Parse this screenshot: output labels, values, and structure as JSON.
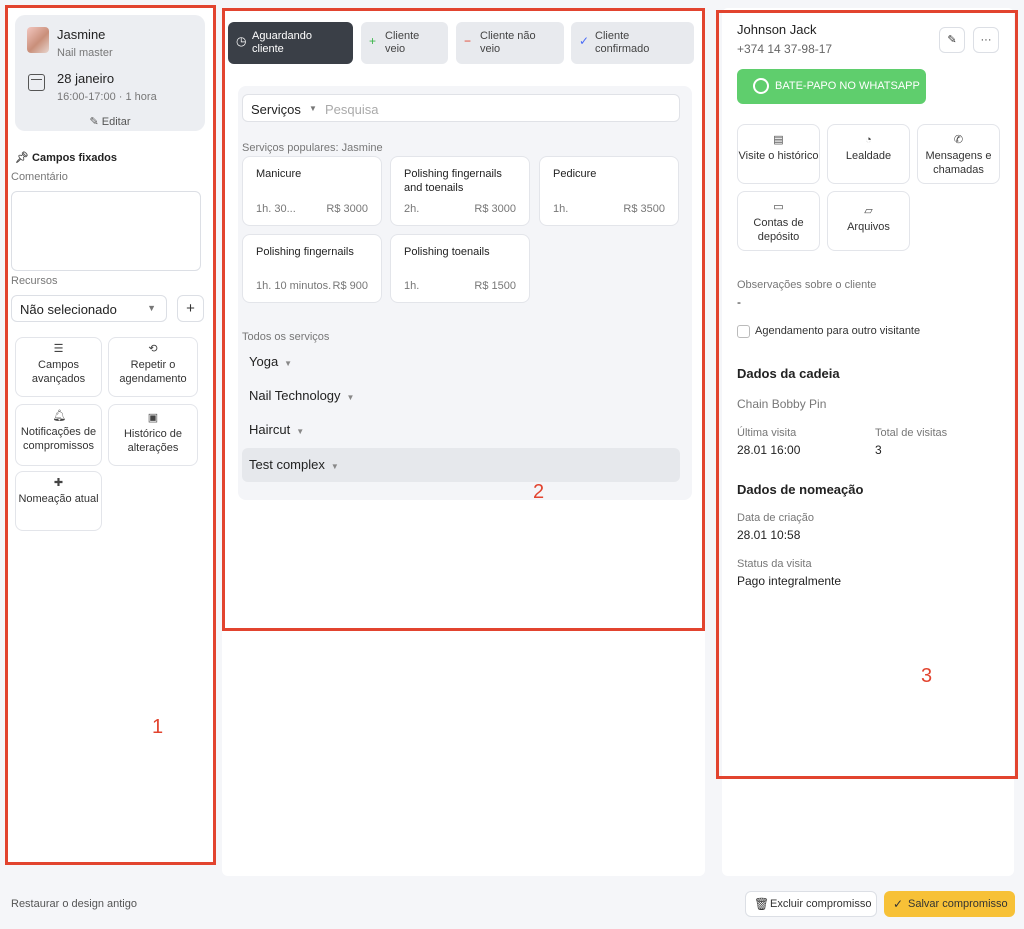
{
  "left": {
    "master_name": "Jasmine",
    "master_role": "Nail master",
    "date": "28 janeiro",
    "time": "16:00-17:00 · 1 hora",
    "edit_label": "Editar",
    "pinned_label": "Campos fixados",
    "comment_label": "Comentário",
    "resources_label": "Recursos",
    "resources_value": "Não selecionado",
    "tiles": [
      {
        "label": "Campos avançados",
        "icon": "list-icon"
      },
      {
        "label": "Repetir o agendamento",
        "icon": "repeat-icon"
      },
      {
        "label": "Notificações de compromissos",
        "icon": "bell-icon"
      },
      {
        "label": "Histórico de alterações",
        "icon": "history-icon"
      },
      {
        "label": "Nomeação atual",
        "icon": "plus-icon"
      }
    ]
  },
  "middle": {
    "statuses": [
      {
        "label": "Aguardando cliente",
        "icon": "clock-icon",
        "active": true
      },
      {
        "label": "Cliente veio",
        "icon": "plus-icon",
        "color": "#3bb54a"
      },
      {
        "label": "Cliente não veio",
        "icon": "minus-icon",
        "color": "#e2442f"
      },
      {
        "label": "Cliente confirmado",
        "icon": "check-icon",
        "color": "#4a6cf7"
      }
    ],
    "services_dropdown": "Serviços",
    "search_placeholder": "Pesquisa",
    "popular_label": "Serviços populares: Jasmine",
    "popular": [
      {
        "name": "Manicure",
        "duration": "1h. 30...",
        "price": "R$ 3000"
      },
      {
        "name": "Polishing fingernails and toenails",
        "duration": "2h.",
        "price": "R$ 3000"
      },
      {
        "name": "Pedicure",
        "duration": "1h.",
        "price": "R$ 3500"
      },
      {
        "name": "Polishing fingernails",
        "duration": "1h. 10 minutos.",
        "price": "R$ 900"
      },
      {
        "name": "Polishing toenails",
        "duration": "1h.",
        "price": "R$ 1500"
      }
    ],
    "all_label": "Todos os serviços",
    "categories": [
      "Yoga",
      "Nail Technology",
      "Haircut",
      "Test complex"
    ]
  },
  "right": {
    "client_name": "Johnson Jack",
    "client_phone": "+374 14 37-98-17",
    "whatsapp_label": "BATE-PAPO NO WHATSAPP",
    "tiles": [
      {
        "label": "Visite o histórico",
        "icon": "document-icon"
      },
      {
        "label": "Lealdade",
        "icon": "loyalty-icon"
      },
      {
        "label": "Mensagens e chamadas",
        "icon": "phone-icon"
      },
      {
        "label": "Contas de depósito",
        "icon": "briefcase-icon"
      },
      {
        "label": "Arquivos",
        "icon": "folder-icon"
      }
    ],
    "notes_label": "Observações sobre o cliente",
    "notes_value": "-",
    "other_visitor_label": "Agendamento para outro visitante",
    "chain_heading": "Dados da cadeia",
    "chain_name": "Chain Bobby Pin",
    "last_visit_label": "Última visita",
    "last_visit_value": "28.01 16:00",
    "total_visits_label": "Total de visitas",
    "total_visits_value": "3",
    "appointment_heading": "Dados de nomeação",
    "created_label": "Data de criação",
    "created_value": "28.01 10:58",
    "status_label": "Status da visita",
    "status_value": "Pago integralmente"
  },
  "footer": {
    "restore_label": "Restaurar o design antigo",
    "delete_label": "Excluir compromisso",
    "save_label": "Salvar compromisso"
  },
  "annotations": [
    "1",
    "2",
    "3"
  ],
  "colors": {
    "annotation_red": "#e2442f",
    "whatsapp_green": "#5fce6d",
    "save_yellow": "#f7c137",
    "active_dark": "#3a3f47"
  }
}
